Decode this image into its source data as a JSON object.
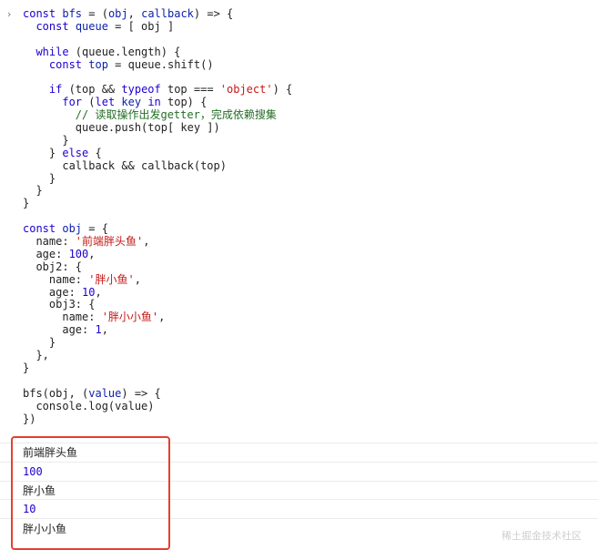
{
  "console": {
    "prompt_glyph": "›",
    "code_lines": [
      [
        {
          "t": "const ",
          "c": "def"
        },
        {
          "t": "bfs",
          "c": "id"
        },
        {
          "t": " = (",
          "c": ""
        },
        {
          "t": "obj",
          "c": "id"
        },
        {
          "t": ", ",
          "c": ""
        },
        {
          "t": "callback",
          "c": "id"
        },
        {
          "t": ") => {",
          "c": ""
        }
      ],
      [
        {
          "t": "  ",
          "c": ""
        },
        {
          "t": "const ",
          "c": "def"
        },
        {
          "t": "queue",
          "c": "id"
        },
        {
          "t": " = [ obj ]",
          "c": ""
        }
      ],
      [
        {
          "t": "",
          "c": ""
        }
      ],
      [
        {
          "t": "  ",
          "c": ""
        },
        {
          "t": "while",
          "c": "def"
        },
        {
          "t": " (queue.length) {",
          "c": ""
        }
      ],
      [
        {
          "t": "    ",
          "c": ""
        },
        {
          "t": "const ",
          "c": "def"
        },
        {
          "t": "top",
          "c": "id"
        },
        {
          "t": " = queue.shift()",
          "c": ""
        }
      ],
      [
        {
          "t": "",
          "c": ""
        }
      ],
      [
        {
          "t": "    ",
          "c": ""
        },
        {
          "t": "if",
          "c": "def"
        },
        {
          "t": " (top && ",
          "c": ""
        },
        {
          "t": "typeof",
          "c": "def"
        },
        {
          "t": " top === ",
          "c": ""
        },
        {
          "t": "'object'",
          "c": "str"
        },
        {
          "t": ") {",
          "c": ""
        }
      ],
      [
        {
          "t": "      ",
          "c": ""
        },
        {
          "t": "for",
          "c": "def"
        },
        {
          "t": " (",
          "c": ""
        },
        {
          "t": "let ",
          "c": "def"
        },
        {
          "t": "key",
          "c": "id"
        },
        {
          "t": " ",
          "c": ""
        },
        {
          "t": "in",
          "c": "def"
        },
        {
          "t": " top) {",
          "c": ""
        }
      ],
      [
        {
          "t": "        ",
          "c": ""
        },
        {
          "t": "// 读取操作出发getter，完成依赖搜集",
          "c": "cmt"
        }
      ],
      [
        {
          "t": "        queue.push(top[ key ])",
          "c": ""
        }
      ],
      [
        {
          "t": "      }",
          "c": ""
        }
      ],
      [
        {
          "t": "    } ",
          "c": ""
        },
        {
          "t": "else",
          "c": "def"
        },
        {
          "t": " {",
          "c": ""
        }
      ],
      [
        {
          "t": "      callback && callback(top)",
          "c": ""
        }
      ],
      [
        {
          "t": "    }",
          "c": ""
        }
      ],
      [
        {
          "t": "  }",
          "c": ""
        }
      ],
      [
        {
          "t": "}",
          "c": ""
        }
      ],
      [
        {
          "t": "",
          "c": ""
        }
      ],
      [
        {
          "t": "const ",
          "c": "def"
        },
        {
          "t": "obj",
          "c": "id"
        },
        {
          "t": " = {",
          "c": ""
        }
      ],
      [
        {
          "t": "  name: ",
          "c": ""
        },
        {
          "t": "'前端胖头鱼'",
          "c": "str"
        },
        {
          "t": ",",
          "c": ""
        }
      ],
      [
        {
          "t": "  age: ",
          "c": ""
        },
        {
          "t": "100",
          "c": "num"
        },
        {
          "t": ",",
          "c": ""
        }
      ],
      [
        {
          "t": "  obj2: {",
          "c": ""
        }
      ],
      [
        {
          "t": "    name: ",
          "c": ""
        },
        {
          "t": "'胖小鱼'",
          "c": "str"
        },
        {
          "t": ",",
          "c": ""
        }
      ],
      [
        {
          "t": "    age: ",
          "c": ""
        },
        {
          "t": "10",
          "c": "num"
        },
        {
          "t": ",",
          "c": ""
        }
      ],
      [
        {
          "t": "    obj3: {",
          "c": ""
        }
      ],
      [
        {
          "t": "      name: ",
          "c": ""
        },
        {
          "t": "'胖小小鱼'",
          "c": "str"
        },
        {
          "t": ",",
          "c": ""
        }
      ],
      [
        {
          "t": "      age: ",
          "c": ""
        },
        {
          "t": "1",
          "c": "num"
        },
        {
          "t": ",",
          "c": ""
        }
      ],
      [
        {
          "t": "    }",
          "c": ""
        }
      ],
      [
        {
          "t": "  },",
          "c": ""
        }
      ],
      [
        {
          "t": "}",
          "c": ""
        }
      ],
      [
        {
          "t": "",
          "c": ""
        }
      ],
      [
        {
          "t": "bfs(obj, (",
          "c": ""
        },
        {
          "t": "value",
          "c": "id"
        },
        {
          "t": ") => {",
          "c": ""
        }
      ],
      [
        {
          "t": "  console.log(value)",
          "c": ""
        }
      ],
      [
        {
          "t": "})",
          "c": ""
        }
      ]
    ],
    "outputs": [
      {
        "text": "前端胖头鱼",
        "kind": "text"
      },
      {
        "text": "100",
        "kind": "number"
      },
      {
        "text": "胖小鱼",
        "kind": "text"
      },
      {
        "text": "10",
        "kind": "number"
      },
      {
        "text": "胖小小鱼",
        "kind": "text"
      }
    ],
    "watermark": "稀土掘金技术社区",
    "highlight_color": "#e53f2f"
  }
}
